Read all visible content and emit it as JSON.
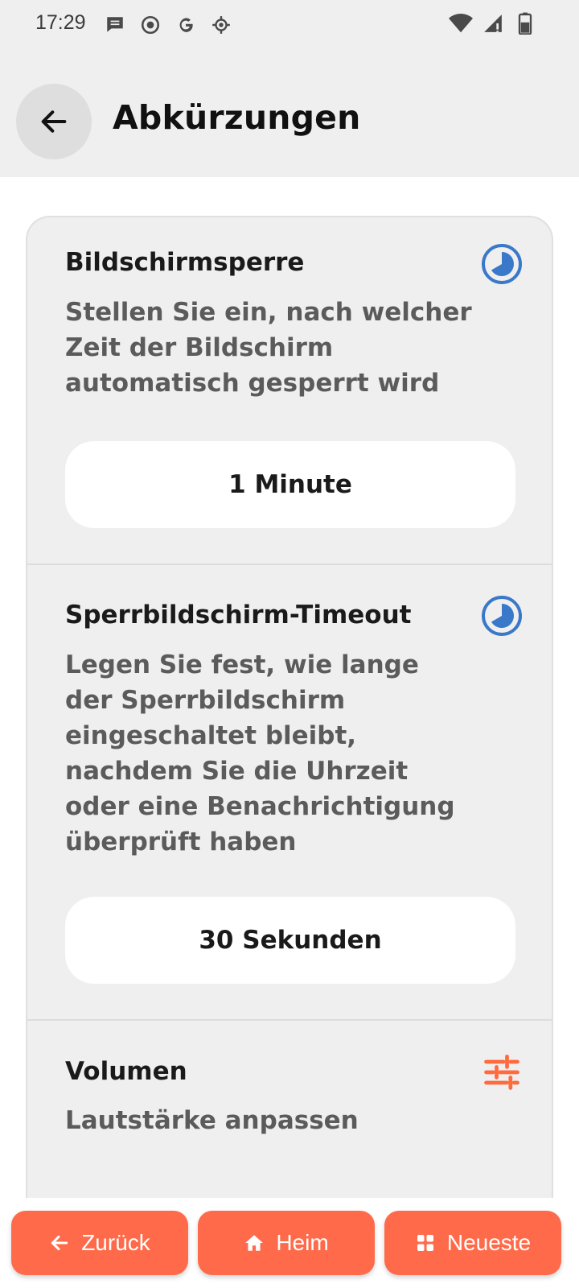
{
  "status": {
    "time": "17:29",
    "left_icons": [
      "message-icon",
      "record-icon",
      "google-icon",
      "location-icon"
    ],
    "right_icons": [
      "wifi-icon",
      "signal-icon",
      "battery-icon"
    ]
  },
  "header": {
    "title": "Abkürzungen",
    "back_icon": "arrow-left-icon"
  },
  "sections": [
    {
      "title": "Bildschirmsperre",
      "description": "Stellen Sie ein, nach welcher Zeit der Bildschirm automatisch gesperrt wird",
      "value": "1 Minute",
      "icon": "timer-icon"
    },
    {
      "title": "Sperrbildschirm-Timeout",
      "description": "Legen Sie fest, wie lange der Sperrbildschirm eingeschaltet bleibt, nachdem Sie die Uhrzeit oder eine Benachrichtigung überprüft haben",
      "value": "30 Sekunden",
      "icon": "timer-icon"
    },
    {
      "title": "Volumen",
      "description": "Lautstärke anpassen",
      "icon": "sliders-icon"
    }
  ],
  "nav": {
    "back": "Zurück",
    "home": "Heim",
    "recent": "Neueste"
  },
  "colors": {
    "accent": "#ff6b4a",
    "timer_icon": "#3a78c9",
    "sliders_icon": "#ff6b3d",
    "card_bg": "#efefef"
  }
}
